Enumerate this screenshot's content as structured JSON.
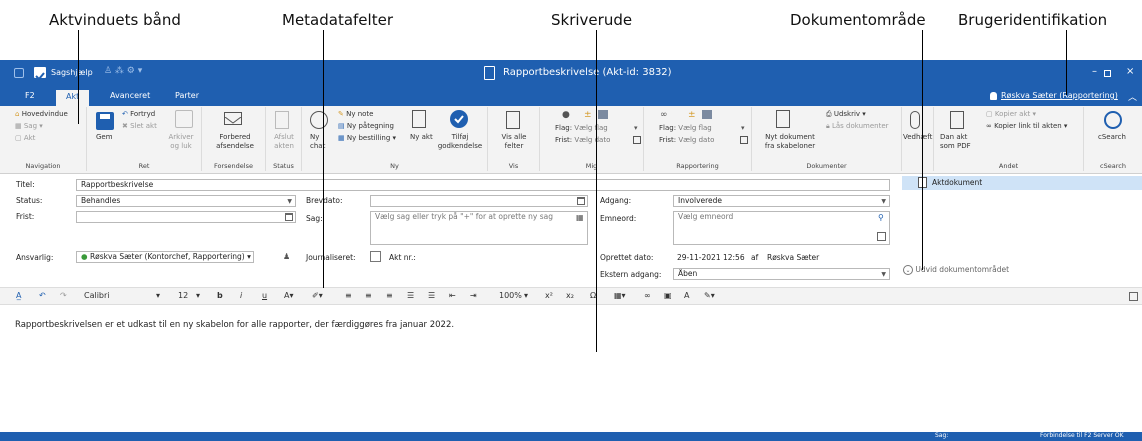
{
  "callouts": {
    "ribbon": "Aktvinduets bånd",
    "metadata": "Metadatafelter",
    "editor": "Skriverude",
    "document_area": "Dokumentområde",
    "user_id": "Brugeridentifikation"
  },
  "titlebar": {
    "quick_title": "Sagshjælp",
    "window_title": "Rapportbeskrivelse (Akt-id: 3832)"
  },
  "tabs": [
    "F2",
    "Akt",
    "Avanceret",
    "Parter"
  ],
  "user": "Røskva Sæter (Rapportering)",
  "ribbon": {
    "navigation": {
      "label": "Navigation",
      "items": [
        "Hovedvindue",
        "Sag",
        "Akt"
      ]
    },
    "ret": {
      "label": "Ret",
      "save": "Gem",
      "undo": "Fortryd",
      "delete": "Slet akt",
      "archive": "Arkiver og luk"
    },
    "forsendelse": {
      "label": "Forsendelse",
      "prepare": "Forbered afsendelse"
    },
    "status": {
      "label": "Status",
      "close": "Afslut akten"
    },
    "ny": {
      "label": "Ny",
      "chat": "Ny chat",
      "note": "Ny note",
      "paategning": "Ny påtegning",
      "bestilling": "Ny bestilling",
      "akt": "Ny akt",
      "approve": "Tilføj godkendelse"
    },
    "vis": {
      "label": "Vis",
      "show_all": "Vis alle felter"
    },
    "mig": {
      "label": "Mig",
      "flag": "Flag:",
      "flag_val": "Vælg flag",
      "frist": "Frist:",
      "frist_val": "Vælg dato"
    },
    "rapportering": {
      "label": "Rapportering",
      "flag": "Flag:",
      "flag_val": "Vælg flag",
      "frist": "Frist:",
      "frist_val": "Vælg dato"
    },
    "dokumenter": {
      "label": "Dokumenter",
      "new_doc": "Nyt dokument fra skabeloner",
      "print": "Udskriv",
      "lock": "Lås dokumenter"
    },
    "vedhaeft": "Vedhæft",
    "andet": {
      "label": "Andet",
      "pdf": "Dan akt som PDF",
      "copy": "Kopier akt",
      "copy_link": "Kopier link til akten"
    },
    "csearch": {
      "label": "cSearch",
      "btn": "cSearch"
    }
  },
  "form": {
    "title_label": "Titel:",
    "title_value": "Rapportbeskrivelse",
    "status_label": "Status:",
    "status_value": "Behandles",
    "frist_label": "Frist:",
    "brevdato_label": "Brevdato:",
    "sag_label": "Sag:",
    "sag_placeholder": "Vælg sag eller tryk på \"+\" for at oprette ny sag",
    "ansvarlig_label": "Ansvarlig:",
    "ansvarlig_value": "Røskva Sæter (Kontorchef, Rapportering)",
    "journal_label": "Journaliseret:",
    "aktnr_label": "Akt nr.:",
    "adgang_label": "Adgang:",
    "adgang_value": "Involverede",
    "emneord_label": "Emneord:",
    "emneord_placeholder": "Vælg emneord",
    "oprettet_label": "Oprettet dato:",
    "oprettet_value": "29-11-2021 12:56",
    "af": "af",
    "oprettet_by": "Røskva Sæter",
    "ekstern_label": "Ekstern adgang:",
    "ekstern_value": "Åben"
  },
  "docpane": {
    "item": "Aktdokument",
    "expand": "Udvid dokumentområdet"
  },
  "editor": {
    "font": "Calibri",
    "size": "12",
    "zoom": "100%",
    "body": "Rapportbeskrivelsen er et udkast til en ny skabelon for alle rapporter, der færdiggøres fra januar 2022."
  },
  "status": {
    "left": "Sag:",
    "right": "Forbindelse til F2 Server OK"
  },
  "colors": {
    "ribbon_blue": "#1f5fb0",
    "selection": "#cfe3f7"
  }
}
